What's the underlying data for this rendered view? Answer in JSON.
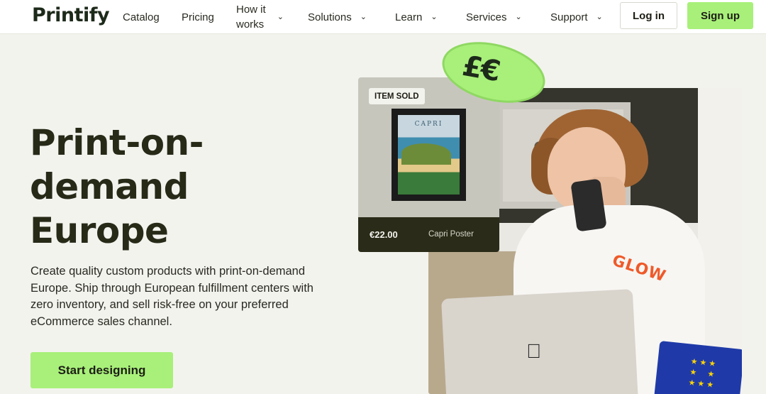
{
  "header": {
    "logo": "Printify",
    "nav": [
      {
        "label": "Catalog",
        "dropdown": false
      },
      {
        "label": "Pricing",
        "dropdown": false
      },
      {
        "label": "How it works",
        "line1": "How it",
        "line2": "works",
        "dropdown": true
      },
      {
        "label": "Solutions",
        "dropdown": true
      },
      {
        "label": "Learn",
        "dropdown": true
      },
      {
        "label": "Services",
        "dropdown": true
      },
      {
        "label": "Support",
        "dropdown": true
      }
    ],
    "login": "Log in",
    "signup": "Sign up"
  },
  "hero": {
    "title": "Print-on-demand Europe",
    "title_lines": [
      "Print-on-",
      "demand",
      "Europe"
    ],
    "description": "Create quality custom products with print-on-demand Europe. Ship through European fulfillment centers with zero inventory, and sell risk-free on your preferred eCommerce sales channel.",
    "cta": "Start designing"
  },
  "product_card": {
    "badge": "ITEM SOLD",
    "poster_title": "CAPRI",
    "price": "€22.00",
    "name": "Capri Poster"
  },
  "currency_bubble": "£€",
  "shirt_logo": "GLOW",
  "colors": {
    "accent_green": "#a8f07a",
    "dark_olive": "#2a2b18",
    "background": "#f3f3ee",
    "shirt_logo": "#ef5a2a",
    "eu_blue": "#1f3aa8"
  },
  "icons": [
    "chevron-down-icon",
    "apple-logo-icon",
    "eu-stars-icon"
  ]
}
